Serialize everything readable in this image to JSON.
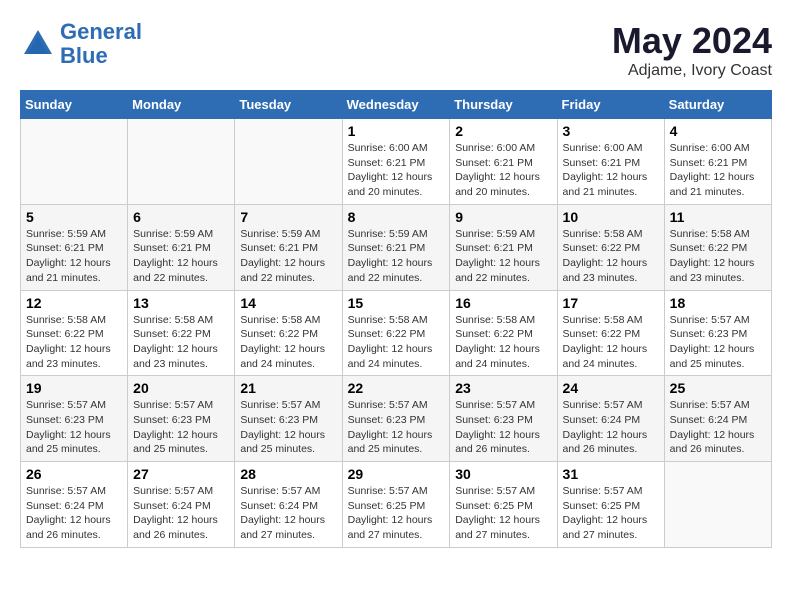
{
  "header": {
    "logo_line1": "General",
    "logo_line2": "Blue",
    "month": "May 2024",
    "location": "Adjame, Ivory Coast"
  },
  "weekdays": [
    "Sunday",
    "Monday",
    "Tuesday",
    "Wednesday",
    "Thursday",
    "Friday",
    "Saturday"
  ],
  "weeks": [
    [
      {
        "day": "",
        "info": ""
      },
      {
        "day": "",
        "info": ""
      },
      {
        "day": "",
        "info": ""
      },
      {
        "day": "1",
        "info": "Sunrise: 6:00 AM\nSunset: 6:21 PM\nDaylight: 12 hours\nand 20 minutes."
      },
      {
        "day": "2",
        "info": "Sunrise: 6:00 AM\nSunset: 6:21 PM\nDaylight: 12 hours\nand 20 minutes."
      },
      {
        "day": "3",
        "info": "Sunrise: 6:00 AM\nSunset: 6:21 PM\nDaylight: 12 hours\nand 21 minutes."
      },
      {
        "day": "4",
        "info": "Sunrise: 6:00 AM\nSunset: 6:21 PM\nDaylight: 12 hours\nand 21 minutes."
      }
    ],
    [
      {
        "day": "5",
        "info": "Sunrise: 5:59 AM\nSunset: 6:21 PM\nDaylight: 12 hours\nand 21 minutes."
      },
      {
        "day": "6",
        "info": "Sunrise: 5:59 AM\nSunset: 6:21 PM\nDaylight: 12 hours\nand 22 minutes."
      },
      {
        "day": "7",
        "info": "Sunrise: 5:59 AM\nSunset: 6:21 PM\nDaylight: 12 hours\nand 22 minutes."
      },
      {
        "day": "8",
        "info": "Sunrise: 5:59 AM\nSunset: 6:21 PM\nDaylight: 12 hours\nand 22 minutes."
      },
      {
        "day": "9",
        "info": "Sunrise: 5:59 AM\nSunset: 6:21 PM\nDaylight: 12 hours\nand 22 minutes."
      },
      {
        "day": "10",
        "info": "Sunrise: 5:58 AM\nSunset: 6:22 PM\nDaylight: 12 hours\nand 23 minutes."
      },
      {
        "day": "11",
        "info": "Sunrise: 5:58 AM\nSunset: 6:22 PM\nDaylight: 12 hours\nand 23 minutes."
      }
    ],
    [
      {
        "day": "12",
        "info": "Sunrise: 5:58 AM\nSunset: 6:22 PM\nDaylight: 12 hours\nand 23 minutes."
      },
      {
        "day": "13",
        "info": "Sunrise: 5:58 AM\nSunset: 6:22 PM\nDaylight: 12 hours\nand 23 minutes."
      },
      {
        "day": "14",
        "info": "Sunrise: 5:58 AM\nSunset: 6:22 PM\nDaylight: 12 hours\nand 24 minutes."
      },
      {
        "day": "15",
        "info": "Sunrise: 5:58 AM\nSunset: 6:22 PM\nDaylight: 12 hours\nand 24 minutes."
      },
      {
        "day": "16",
        "info": "Sunrise: 5:58 AM\nSunset: 6:22 PM\nDaylight: 12 hours\nand 24 minutes."
      },
      {
        "day": "17",
        "info": "Sunrise: 5:58 AM\nSunset: 6:22 PM\nDaylight: 12 hours\nand 24 minutes."
      },
      {
        "day": "18",
        "info": "Sunrise: 5:57 AM\nSunset: 6:23 PM\nDaylight: 12 hours\nand 25 minutes."
      }
    ],
    [
      {
        "day": "19",
        "info": "Sunrise: 5:57 AM\nSunset: 6:23 PM\nDaylight: 12 hours\nand 25 minutes."
      },
      {
        "day": "20",
        "info": "Sunrise: 5:57 AM\nSunset: 6:23 PM\nDaylight: 12 hours\nand 25 minutes."
      },
      {
        "day": "21",
        "info": "Sunrise: 5:57 AM\nSunset: 6:23 PM\nDaylight: 12 hours\nand 25 minutes."
      },
      {
        "day": "22",
        "info": "Sunrise: 5:57 AM\nSunset: 6:23 PM\nDaylight: 12 hours\nand 25 minutes."
      },
      {
        "day": "23",
        "info": "Sunrise: 5:57 AM\nSunset: 6:23 PM\nDaylight: 12 hours\nand 26 minutes."
      },
      {
        "day": "24",
        "info": "Sunrise: 5:57 AM\nSunset: 6:24 PM\nDaylight: 12 hours\nand 26 minutes."
      },
      {
        "day": "25",
        "info": "Sunrise: 5:57 AM\nSunset: 6:24 PM\nDaylight: 12 hours\nand 26 minutes."
      }
    ],
    [
      {
        "day": "26",
        "info": "Sunrise: 5:57 AM\nSunset: 6:24 PM\nDaylight: 12 hours\nand 26 minutes."
      },
      {
        "day": "27",
        "info": "Sunrise: 5:57 AM\nSunset: 6:24 PM\nDaylight: 12 hours\nand 26 minutes."
      },
      {
        "day": "28",
        "info": "Sunrise: 5:57 AM\nSunset: 6:24 PM\nDaylight: 12 hours\nand 27 minutes."
      },
      {
        "day": "29",
        "info": "Sunrise: 5:57 AM\nSunset: 6:25 PM\nDaylight: 12 hours\nand 27 minutes."
      },
      {
        "day": "30",
        "info": "Sunrise: 5:57 AM\nSunset: 6:25 PM\nDaylight: 12 hours\nand 27 minutes."
      },
      {
        "day": "31",
        "info": "Sunrise: 5:57 AM\nSunset: 6:25 PM\nDaylight: 12 hours\nand 27 minutes."
      },
      {
        "day": "",
        "info": ""
      }
    ]
  ]
}
